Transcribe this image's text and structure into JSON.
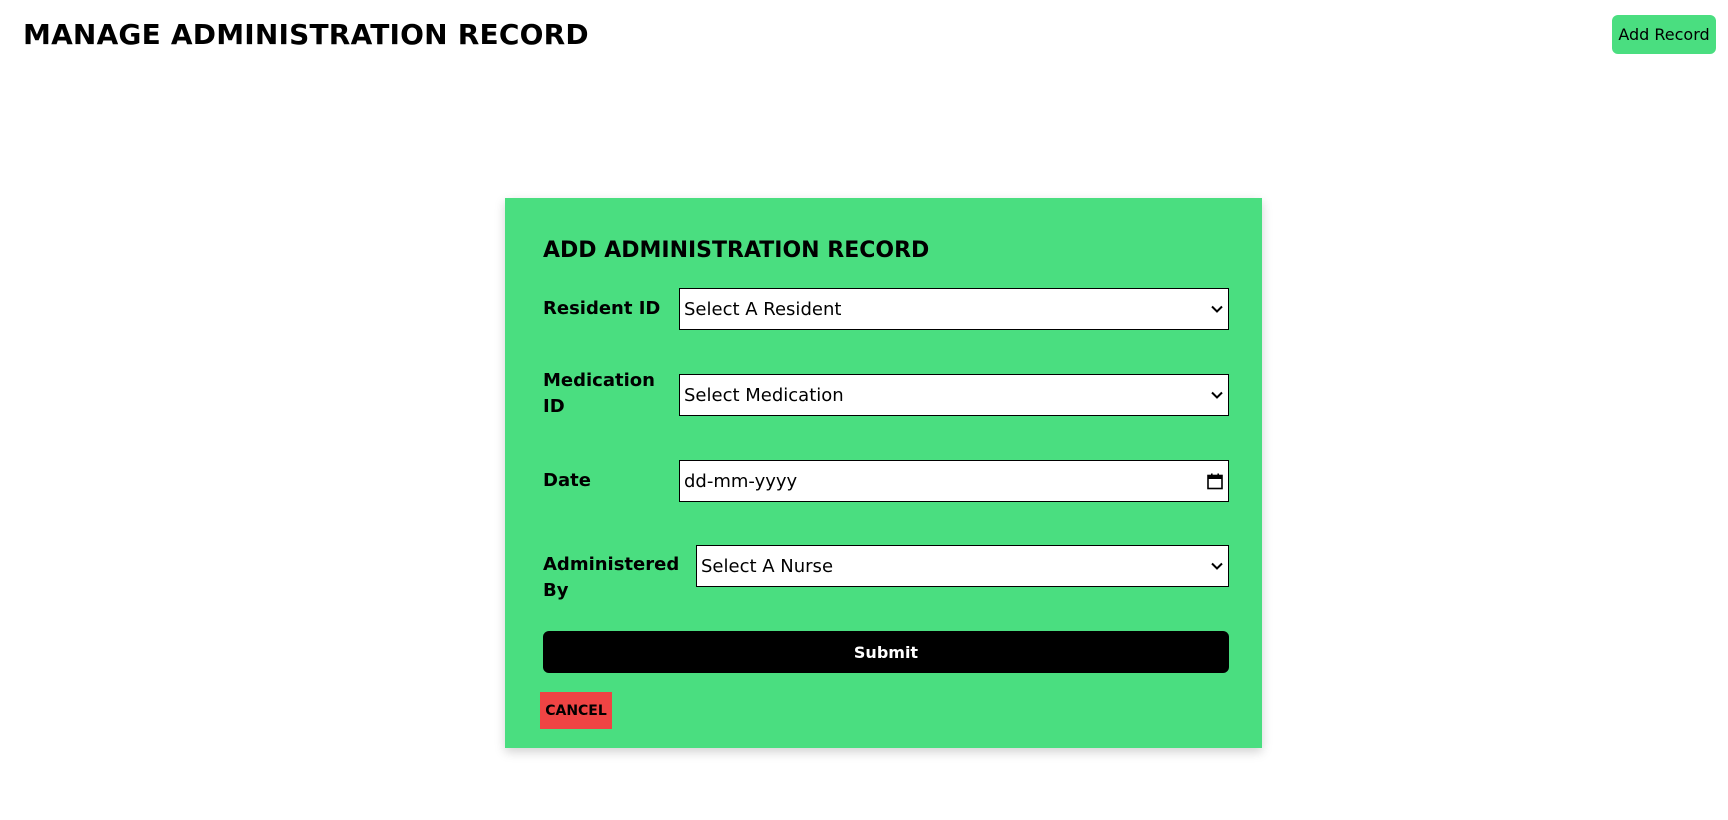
{
  "header": {
    "title": "MANAGE ADMINISTRATION RECORD",
    "add_button_label": "Add Record"
  },
  "modal": {
    "title": "ADD ADMINISTRATION RECORD",
    "fields": [
      {
        "label": "Resident ID",
        "value": "Select A Resident",
        "icon": "chevron-down-icon"
      },
      {
        "label": "Medication ID",
        "value": "Select Medication",
        "icon": "chevron-down-icon"
      },
      {
        "label": "Date",
        "value": "dd-mm-yyyy",
        "icon": "calendar-icon"
      },
      {
        "label": "Administered By",
        "value": "Select A Nurse",
        "icon": "chevron-down-icon"
      }
    ],
    "submit_label": "Submit",
    "cancel_label": "CANCEL"
  },
  "colors": {
    "accent_green": "#4ade80",
    "cancel_red": "#ef4444",
    "submit_black": "#000000"
  }
}
